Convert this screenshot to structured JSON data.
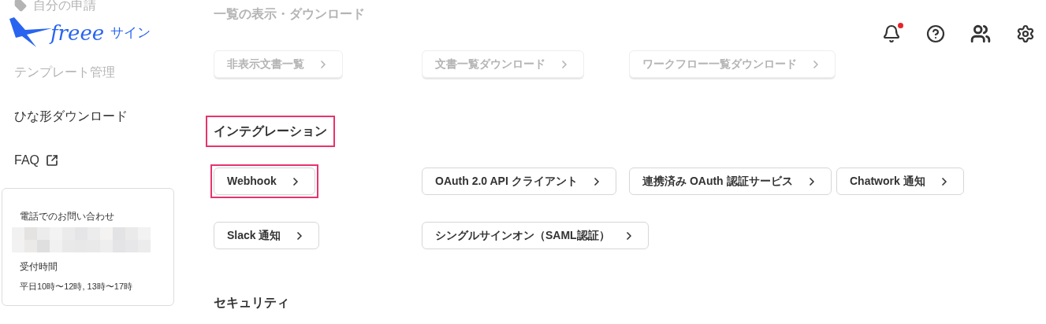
{
  "header": {
    "logo": {
      "wordmark": "freee",
      "suffix": "サイン"
    },
    "notifications": {
      "unread": true
    }
  },
  "sidebar": {
    "items": [
      {
        "label": "自分の申請",
        "faded": true,
        "external": false
      },
      {
        "label": "テンプレート管理",
        "faded": true,
        "external": false
      },
      {
        "label": "ひな形ダウンロード",
        "faded": false,
        "external": false
      },
      {
        "label": "FAQ",
        "faded": false,
        "external": true
      }
    ],
    "contact": {
      "title": "電話でのお問い合わせ",
      "hours_label": "受付時間",
      "hours": "平日10時〜12時, 13時〜17時"
    }
  },
  "sections": [
    {
      "heading": "一覧の表示・ダウンロード",
      "faded": true,
      "highlighted": false,
      "buttons": [
        {
          "label": "非表示文書一覧",
          "highlighted": false
        },
        {
          "label": "文書一覧ダウンロード",
          "highlighted": false
        },
        {
          "label": "ワークフロー一覧ダウンロード",
          "highlighted": false
        }
      ]
    },
    {
      "heading": "インテグレーション",
      "faded": false,
      "highlighted": true,
      "buttons": [
        {
          "label": "Webhook",
          "highlighted": true
        },
        {
          "label": "OAuth 2.0 API クライアント",
          "highlighted": false
        },
        {
          "label": "連携済み OAuth 認証サービス",
          "highlighted": false
        },
        {
          "label": "Chatwork 通知",
          "highlighted": false
        },
        {
          "label": "Slack 通知",
          "highlighted": false
        },
        {
          "label": "シングルサインオン（SAML認証）",
          "highlighted": false
        }
      ]
    },
    {
      "heading": "セキュリティ",
      "faded": false,
      "highlighted": false
    }
  ]
}
